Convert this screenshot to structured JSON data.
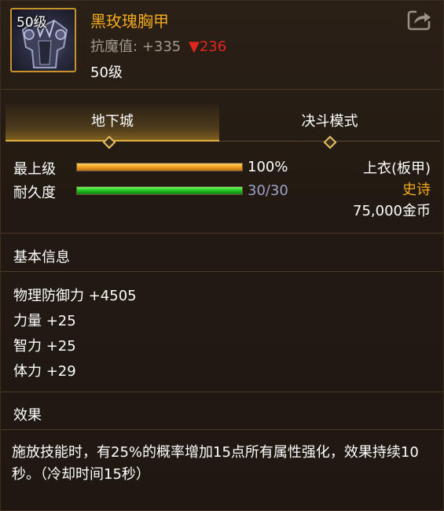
{
  "item": {
    "level_badge": "50级",
    "name": "黑玫瑰胸甲",
    "stat_label": "抗魔值:",
    "stat_value": "+335",
    "stat_diff": "▼236",
    "level_text": "50级"
  },
  "tabs": [
    {
      "label": "地下城",
      "active": true
    },
    {
      "label": "决斗模式",
      "active": false
    }
  ],
  "bars": {
    "max_level": {
      "label": "最上级",
      "value_text": "100%",
      "fraction": 1.0
    },
    "durability": {
      "label": "耐久度",
      "value_text": "30/30",
      "fraction": 1.0
    }
  },
  "side_info": {
    "slot": "上衣(板甲)",
    "rarity": "史诗",
    "price": "75,000金币"
  },
  "basic_info": {
    "title": "基本信息",
    "attributes": [
      "物理防御力 +4505",
      "力量 +25",
      "智力 +25",
      "体力 +29"
    ]
  },
  "effect": {
    "title": "效果",
    "text": "施放技能时，有25%的概率增加15点所有属性强化，效果持续10秒。（冷却时间15秒）"
  },
  "icons": {
    "share": "share-icon",
    "item": "armor-icon"
  },
  "colors": {
    "name": "#f2a91c",
    "rarity": "#f2a91c",
    "diff": "#e5231f",
    "accent": "#e0b040"
  }
}
